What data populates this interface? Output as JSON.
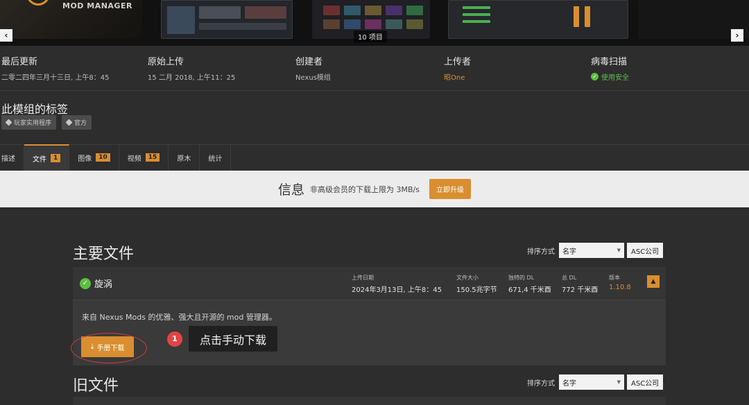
{
  "gallery": {
    "logo_text": "MOD MANAGER",
    "image_count": "10 项目"
  },
  "meta": {
    "last_updated": {
      "label": "最后更新",
      "value": "二零二四年三月十三日, 上午8：45"
    },
    "original_upload": {
      "label": "原始上传",
      "value": "15 二月 2018, 上午11：25"
    },
    "creator": {
      "label": "创建者",
      "value": "Nexus模组"
    },
    "uploader": {
      "label": "上传者",
      "value": "昭One"
    },
    "virus_scan": {
      "label": "病毒扫描",
      "value": "使用安全"
    }
  },
  "tags": {
    "title": "此模组的标签",
    "items": [
      "玩家实用程序",
      "官方"
    ]
  },
  "tabs": [
    {
      "label": "描述",
      "badge": ""
    },
    {
      "label": "文件",
      "badge": "1"
    },
    {
      "label": "图像",
      "badge": "10"
    },
    {
      "label": "视频",
      "badge": "15"
    },
    {
      "label": "原木",
      "badge": ""
    },
    {
      "label": "统计",
      "badge": ""
    }
  ],
  "info_bar": {
    "title": "信息",
    "text": "非高级会员的下载上限为 3MB/s",
    "button": "立即升级"
  },
  "main_files": {
    "title": "主要文件",
    "sort_label": "排序方式",
    "sort_value": "名字",
    "sort_dir": "ASC公司"
  },
  "file": {
    "name": "旋涡",
    "upload_date_label": "上传日期",
    "upload_date": "2024年3月13日, 上午8：45",
    "size_label": "文件大小",
    "size": "150.5兆字节",
    "unique_dl_label": "独特的 DL",
    "unique_dl": "671,4 千米酉",
    "total_dl_label": "总 DL",
    "total_dl": "772 千米酉",
    "version_label": "版本",
    "version": "1.10.8",
    "description": "来自 Nexus Mods 的优雅、强大且开源的 mod 管理器。",
    "download_button": "手册下载"
  },
  "callout": {
    "number": "1",
    "text": "点击手动下载"
  },
  "old_files": {
    "title": "旧文件",
    "sort_label": "排序方式",
    "sort_value": "名字",
    "sort_dir": "ASC公司"
  },
  "colors": {
    "accent": "#d98e2f",
    "background": "#2d2d2d",
    "success": "#5bbf3f",
    "callout_red": "#e24444"
  },
  "icons": [
    "chevron-left-icon",
    "chevron-right-icon",
    "shield-check-icon",
    "tag-icon",
    "check-circle-icon",
    "chevron-up-icon",
    "download-icon"
  ]
}
